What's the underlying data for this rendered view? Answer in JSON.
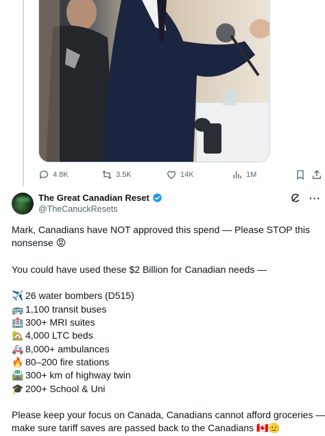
{
  "tweet1": {
    "stats": {
      "replies": "4.8K",
      "reposts": "3.5K",
      "likes": "14K",
      "views": "1M"
    }
  },
  "tweet2": {
    "display_name": "The Great Canadian Reset",
    "handle": "@TheCanuckResets",
    "text_line1": "Mark, Canadians have NOT approved this spend — Please STOP this",
    "text_line2": "nonsense",
    "text_line3": "You could have used these $2 Billion for Canadian needs —",
    "items": [
      {
        "icon": "✈️",
        "label": "26 water bombers (D515)"
      },
      {
        "icon": "🚌",
        "label": "1,100 transit buses"
      },
      {
        "icon": "🏥",
        "label": "300+ MRI suites"
      },
      {
        "icon": "🏡",
        "label": "4,000 LTC beds"
      },
      {
        "icon": "🚑",
        "label": "8,000+ ambulances"
      },
      {
        "icon": "🔥",
        "label": "80–200 fire stations"
      },
      {
        "icon": "🛣️",
        "label": "300+ km of highway twin"
      },
      {
        "icon": "🎓",
        "label": "200+ School & Uni"
      }
    ],
    "text_line4": "Please keep your focus on Canada, Canadians cannot afford groceries —",
    "text_line5": "make sure tariff saves are passed back to the Canadians",
    "angry_emoji": "😡",
    "flag_emoji": "🇨🇦",
    "salute_emoji": "🫡"
  },
  "colors": {
    "verified_blue": "#1d9bf0",
    "muted_text": "#536471"
  }
}
